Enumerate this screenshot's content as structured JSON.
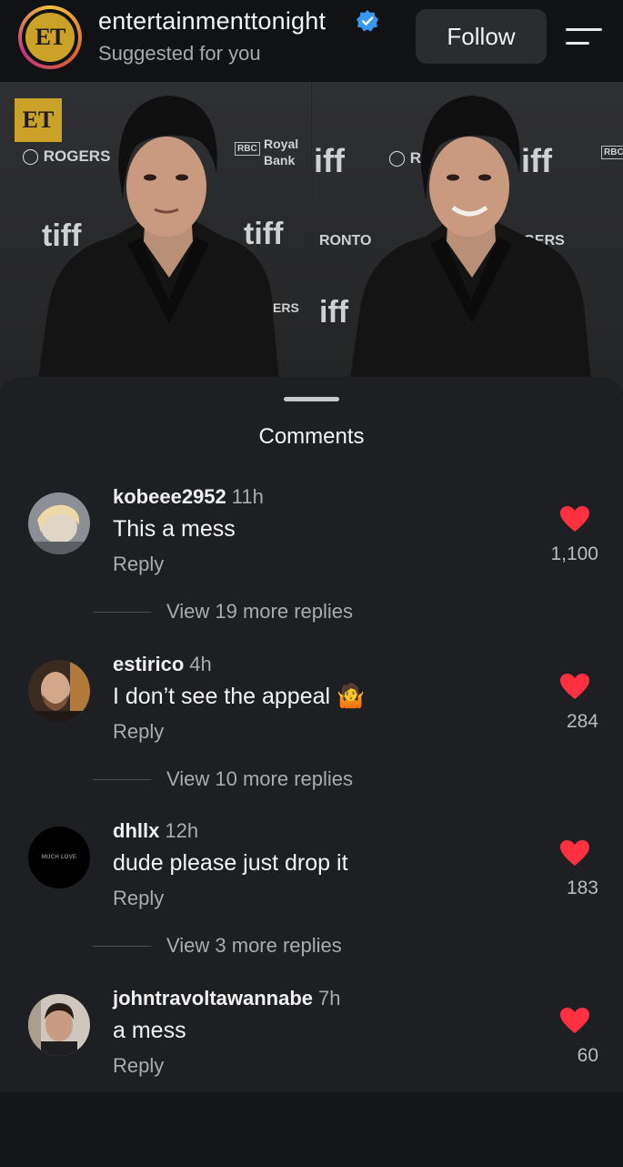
{
  "header": {
    "account_name": "entertainmenttonight",
    "subtitle": "Suggested for you",
    "follow_label": "Follow",
    "avatar_text": "ET"
  },
  "media": {
    "backdrop_labels": {
      "et_badge": "ET",
      "rogers": "ROGERS",
      "tiff": "tiff",
      "royal": "Royal",
      "bank": "Bank",
      "rbc": "RBC",
      "iff": "iff",
      "ronto": "RONTO",
      "ogers": "OGERS",
      "ers": "ERS"
    }
  },
  "comments_panel": {
    "title": "Comments",
    "items": [
      {
        "username": "kobeee2952",
        "time": "11h",
        "text": "This a mess",
        "reply": "Reply",
        "likes": "1,100",
        "view_more": "View 19 more replies"
      },
      {
        "username": "estirico",
        "time": "4h",
        "text": "I don’t see the appeal 🤷",
        "reply": "Reply",
        "likes": "284",
        "view_more": "View 10 more replies"
      },
      {
        "username": "dhllx",
        "time": "12h",
        "text": "dude please just drop it",
        "reply": "Reply",
        "likes": "183",
        "view_more": "View 3 more replies",
        "avatar_text": "MUCH LOVE"
      },
      {
        "username": "johntravoltawannabe",
        "time": "7h",
        "text": "a mess",
        "reply": "Reply",
        "likes": "60"
      }
    ]
  },
  "colors": {
    "heart": "#ff3040",
    "verified": "#3897f0",
    "sheet_bg": "#1e1f23"
  }
}
